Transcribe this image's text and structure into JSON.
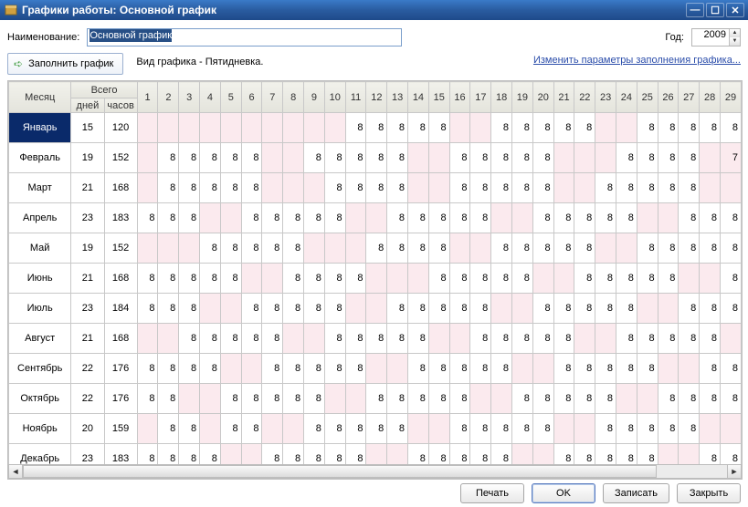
{
  "title": "Графики работы: Основной график",
  "labels": {
    "name": "Наименование:",
    "year": "Год:",
    "fill_schedule": "Заполнить график",
    "schedule_type": "Вид графика - Пятидневка.",
    "edit_params": "Изменить параметры заполнения графика...",
    "month_h": "Месяц",
    "total_h": "Всего",
    "days_h": "дней",
    "hours_h": "часов"
  },
  "name_value": "Основной график",
  "year_value": "2009",
  "footer": {
    "print": "Печать",
    "ok": "OK",
    "save": "Записать",
    "close": "Закрыть"
  },
  "day_headers": [
    1,
    2,
    3,
    4,
    5,
    6,
    7,
    8,
    9,
    10,
    11,
    12,
    13,
    14,
    15,
    16,
    17,
    18,
    19,
    20,
    21,
    22,
    23,
    24,
    25,
    26,
    27,
    28,
    29
  ],
  "months": [
    {
      "name": "Январь",
      "days": 15,
      "hours": 120,
      "cells": [
        0,
        0,
        0,
        0,
        0,
        0,
        0,
        0,
        0,
        0,
        1,
        1,
        1,
        1,
        1,
        0,
        0,
        1,
        1,
        1,
        1,
        1,
        0,
        0,
        1,
        1,
        1,
        1,
        1
      ]
    },
    {
      "name": "Февраль",
      "days": 19,
      "hours": 152,
      "cells": [
        0,
        1,
        1,
        1,
        1,
        1,
        0,
        0,
        1,
        1,
        1,
        1,
        1,
        0,
        0,
        1,
        1,
        1,
        1,
        1,
        0,
        0,
        0,
        1,
        1,
        1,
        1,
        0,
        2
      ]
    },
    {
      "name": "Март",
      "days": 21,
      "hours": 168,
      "cells": [
        0,
        1,
        1,
        1,
        1,
        1,
        0,
        0,
        0,
        1,
        1,
        1,
        1,
        0,
        0,
        1,
        1,
        1,
        1,
        1,
        0,
        0,
        1,
        1,
        1,
        1,
        1,
        0,
        0
      ]
    },
    {
      "name": "Апрель",
      "days": 23,
      "hours": 183,
      "cells": [
        1,
        1,
        1,
        0,
        0,
        1,
        1,
        1,
        1,
        1,
        0,
        0,
        1,
        1,
        1,
        1,
        1,
        0,
        0,
        1,
        1,
        1,
        1,
        1,
        0,
        0,
        1,
        1,
        1
      ]
    },
    {
      "name": "Май",
      "days": 19,
      "hours": 152,
      "cells": [
        0,
        0,
        0,
        1,
        1,
        1,
        1,
        1,
        0,
        0,
        0,
        1,
        1,
        1,
        1,
        0,
        0,
        1,
        1,
        1,
        1,
        1,
        0,
        0,
        1,
        1,
        1,
        1,
        1
      ]
    },
    {
      "name": "Июнь",
      "days": 21,
      "hours": 168,
      "cells": [
        1,
        1,
        1,
        1,
        1,
        0,
        0,
        1,
        1,
        1,
        1,
        0,
        0,
        0,
        1,
        1,
        1,
        1,
        1,
        0,
        0,
        1,
        1,
        1,
        1,
        1,
        0,
        0,
        1
      ]
    },
    {
      "name": "Июль",
      "days": 23,
      "hours": 184,
      "cells": [
        1,
        1,
        1,
        0,
        0,
        1,
        1,
        1,
        1,
        1,
        0,
        0,
        1,
        1,
        1,
        1,
        1,
        0,
        0,
        1,
        1,
        1,
        1,
        1,
        0,
        0,
        1,
        1,
        1
      ]
    },
    {
      "name": "Август",
      "days": 21,
      "hours": 168,
      "cells": [
        0,
        0,
        1,
        1,
        1,
        1,
        1,
        0,
        0,
        1,
        1,
        1,
        1,
        1,
        0,
        0,
        1,
        1,
        1,
        1,
        1,
        0,
        0,
        1,
        1,
        1,
        1,
        1,
        0
      ]
    },
    {
      "name": "Сентябрь",
      "days": 22,
      "hours": 176,
      "cells": [
        1,
        1,
        1,
        1,
        0,
        0,
        1,
        1,
        1,
        1,
        1,
        0,
        0,
        1,
        1,
        1,
        1,
        1,
        0,
        0,
        1,
        1,
        1,
        1,
        1,
        0,
        0,
        1,
        1
      ]
    },
    {
      "name": "Октябрь",
      "days": 22,
      "hours": 176,
      "cells": [
        1,
        1,
        0,
        0,
        1,
        1,
        1,
        1,
        1,
        0,
        0,
        1,
        1,
        1,
        1,
        1,
        0,
        0,
        1,
        1,
        1,
        1,
        1,
        0,
        0,
        1,
        1,
        1,
        1
      ]
    },
    {
      "name": "Ноябрь",
      "days": 20,
      "hours": 159,
      "cells": [
        0,
        1,
        1,
        0,
        1,
        1,
        0,
        0,
        1,
        1,
        1,
        1,
        1,
        0,
        0,
        1,
        1,
        1,
        1,
        1,
        0,
        0,
        1,
        1,
        1,
        1,
        1,
        0,
        0
      ]
    },
    {
      "name": "Декабрь",
      "days": 23,
      "hours": 183,
      "cells": [
        1,
        1,
        1,
        1,
        0,
        0,
        1,
        1,
        1,
        1,
        1,
        0,
        0,
        1,
        1,
        1,
        1,
        1,
        0,
        0,
        1,
        1,
        1,
        1,
        1,
        0,
        0,
        1,
        1
      ]
    }
  ]
}
